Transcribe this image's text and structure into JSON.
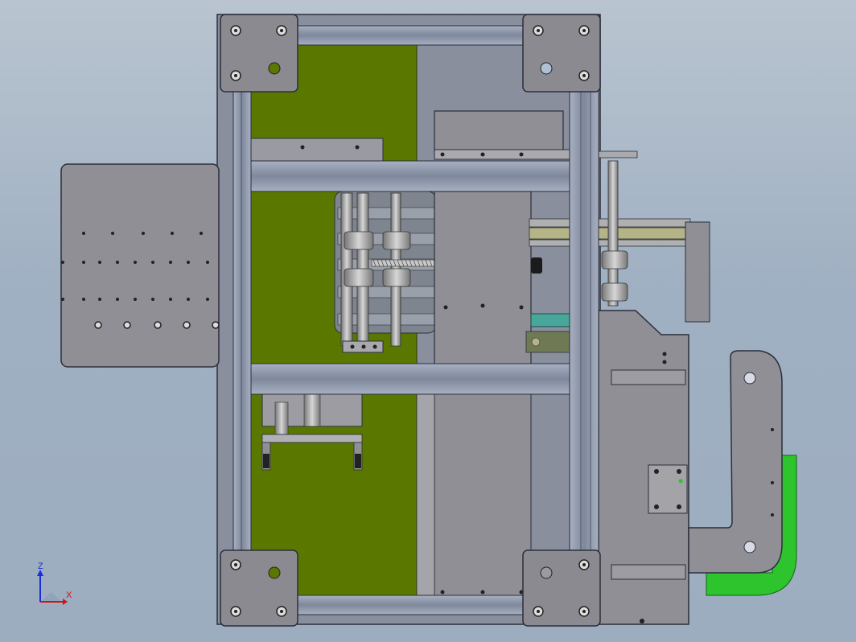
{
  "viewport": {
    "background_top": "#b9c4d0",
    "background_bottom": "#9cadbf"
  },
  "colors": {
    "frame_steel": "#8d96aa",
    "frame_edge": "#2b2f3a",
    "plate_gray": "#8f8f95",
    "panel_green": "#5a7800",
    "accent_teal": "#47a79a",
    "accent_green": "#2ec42e",
    "belt_khaki": "#b4b487"
  },
  "triad": {
    "x_label": "X",
    "z_label": "Z",
    "x_color": "#d0121b",
    "z_color": "#1a2fd8"
  }
}
